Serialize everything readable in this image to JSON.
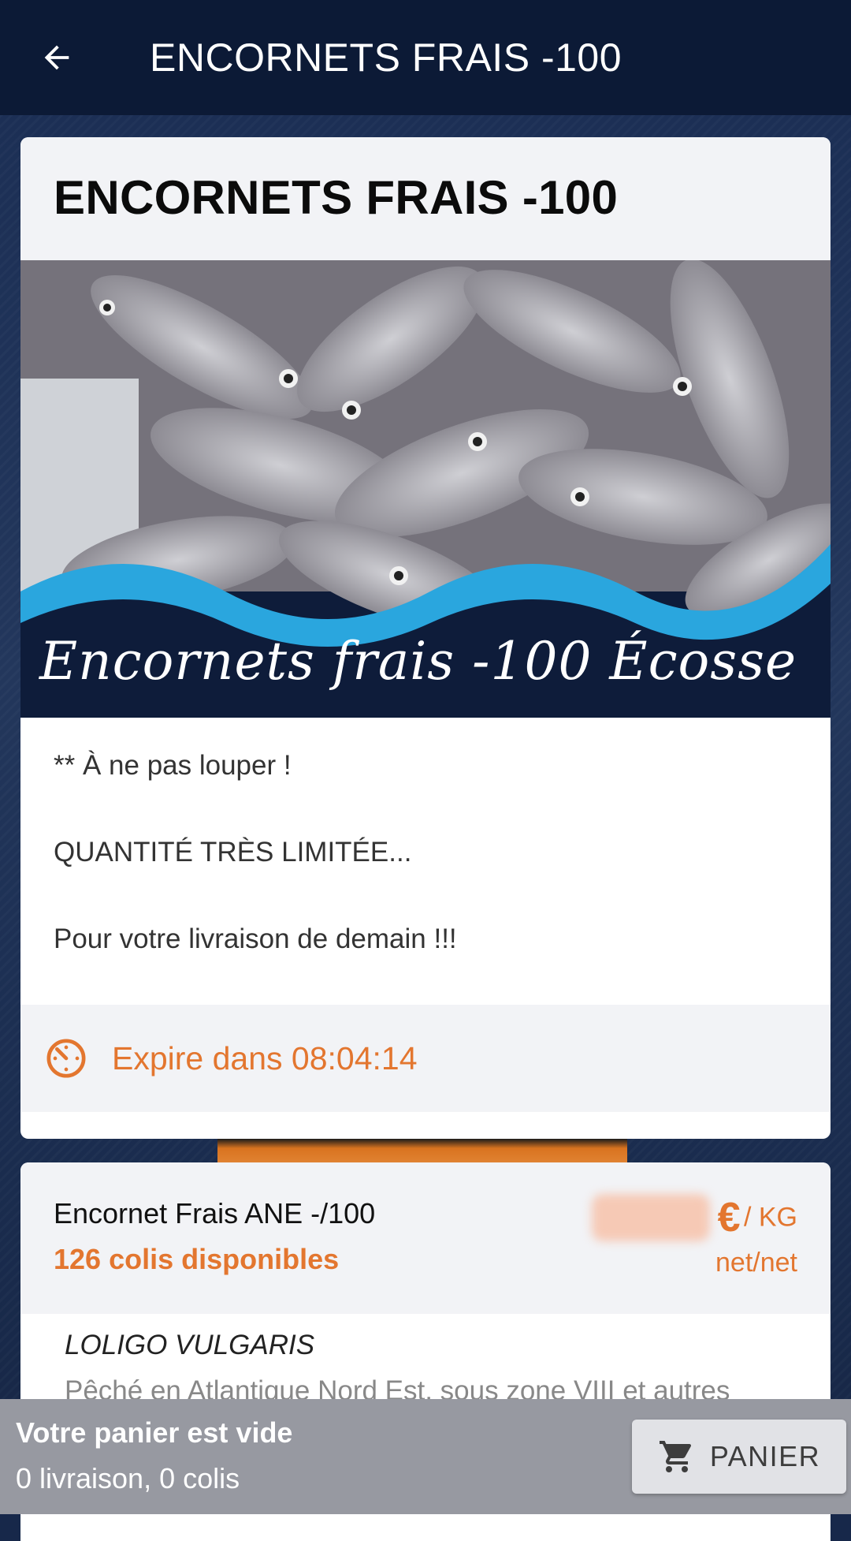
{
  "appbar": {
    "title": "ENCORNETS FRAIS -100",
    "back_icon": "arrow-back-icon"
  },
  "offer": {
    "title": "ENCORNETS FRAIS -100",
    "image_caption": "Encornets frais -100 Écosse",
    "description": [
      "** À ne pas louper !",
      "QUANTITÉ TRÈS LIMITÉE...",
      "Pour votre livraison de demain !!!"
    ],
    "expire_text": "Expire dans 08:04:14",
    "timer_icon": "timer-icon"
  },
  "product": {
    "name": "Encornet Frais ANE -/100",
    "availability": "126 colis disponibles",
    "price_currency": "€",
    "price_unit": "/ KG",
    "price_note": "net/net",
    "species": "LOLIGO VULGARIS",
    "origin": "Pêché en Atlantique Nord Est, sous zone VIII et autres"
  },
  "cart": {
    "status": "Votre panier est vide",
    "summary": "0 livraison, 0 colis",
    "button_label": "PANIER",
    "cart_icon": "shopping-cart-icon"
  },
  "colors": {
    "accent": "#e3762f",
    "appbar": "#0c1a36",
    "wave": "#2aa6de"
  }
}
